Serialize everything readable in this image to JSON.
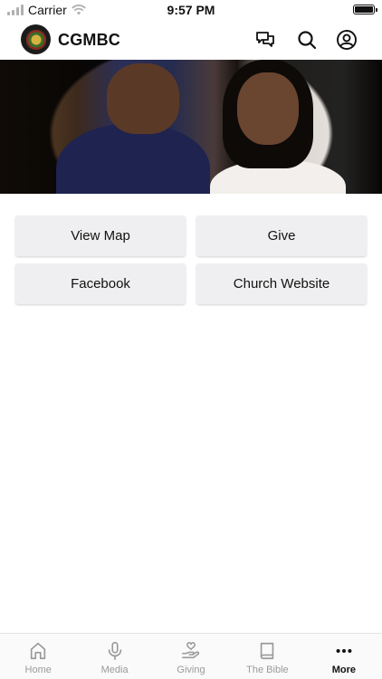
{
  "status_bar": {
    "carrier": "Carrier",
    "time": "9:57 PM"
  },
  "header": {
    "app_title": "CGMBC",
    "icons": [
      "chat-icon",
      "search-icon",
      "account-icon"
    ]
  },
  "buttons": [
    {
      "label": "View Map"
    },
    {
      "label": "Give"
    },
    {
      "label": "Facebook"
    },
    {
      "label": "Church Website"
    }
  ],
  "tab_bar": {
    "tabs": [
      {
        "label": "Home",
        "icon": "home-icon",
        "active": false
      },
      {
        "label": "Media",
        "icon": "microphone-icon",
        "active": false
      },
      {
        "label": "Giving",
        "icon": "giving-hand-icon",
        "active": false
      },
      {
        "label": "The Bible",
        "icon": "book-icon",
        "active": false
      },
      {
        "label": "More",
        "icon": "more-icon",
        "active": true
      }
    ]
  },
  "colors": {
    "button_bg": "#efeff1",
    "tab_inactive": "#9a9a9a",
    "tab_active": "#111111"
  }
}
